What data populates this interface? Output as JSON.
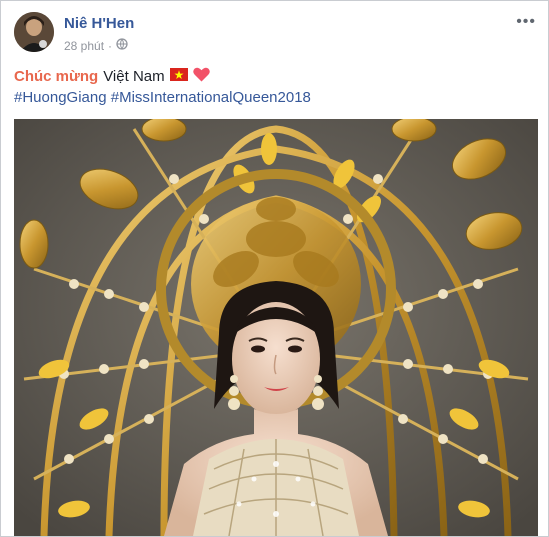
{
  "post": {
    "author": "Niê H'Hen",
    "time": "28 phút",
    "separator": "·",
    "privacy_icon": "globe-icon",
    "more_icon": "more-options-icon",
    "more_label": "•••"
  },
  "message": {
    "highlight": "Chúc mừng",
    "text": "Việt Nam",
    "emojis": [
      "vietnam-flag",
      "heart"
    ],
    "hashtags": [
      "#HuongGiang",
      "#MissInternationalQueen2018"
    ]
  },
  "colors": {
    "name": "#365899",
    "meta": "#90949c",
    "highlight": "#e8674d",
    "hashtag": "#365899",
    "heart": "#f25268",
    "flag_red": "#da251d",
    "flag_star": "#ffff00"
  }
}
